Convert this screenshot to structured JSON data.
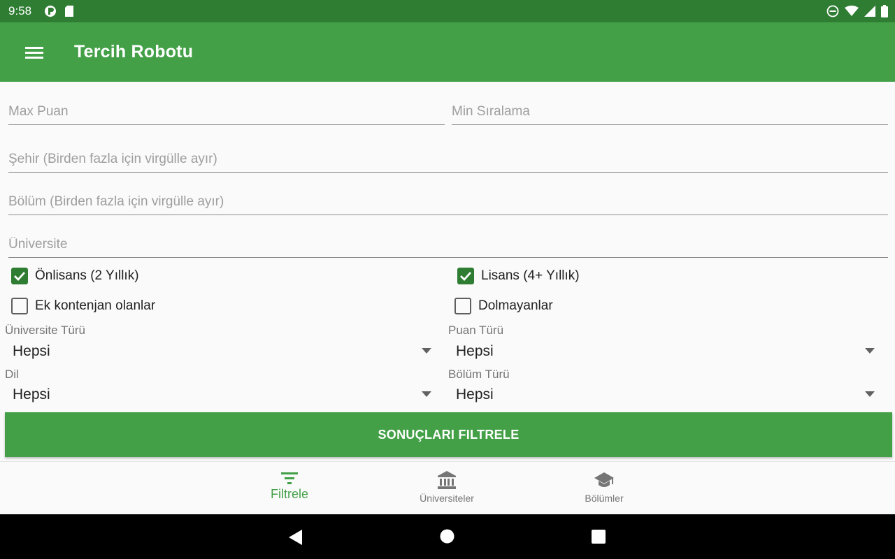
{
  "status_bar": {
    "time": "9:58",
    "left_icons": [
      "sync-icon",
      "sd-card-icon"
    ],
    "right_icons": [
      "do-not-disturb-icon",
      "wifi-icon",
      "signal-icon",
      "battery-icon"
    ]
  },
  "app_bar": {
    "title": "Tercih Robotu",
    "menu_icon": "menu-icon"
  },
  "form": {
    "max_puan": {
      "placeholder": "Max Puan",
      "value": ""
    },
    "min_siralama": {
      "placeholder": "Min Sıralama",
      "value": ""
    },
    "sehir": {
      "placeholder": "Şehir (Birden fazla için virgülle ayır)",
      "value": ""
    },
    "bolum": {
      "placeholder": "Bölüm (Birden fazla için virgülle ayır)",
      "value": ""
    },
    "universite": {
      "placeholder": "Üniversite",
      "value": ""
    },
    "checkboxes": {
      "onlisans": {
        "label": "Önlisans (2 Yıllık)",
        "checked": true
      },
      "lisans": {
        "label": "Lisans (4+ Yıllık)",
        "checked": true
      },
      "ek_kontenjan": {
        "label": "Ek kontenjan olanlar",
        "checked": false
      },
      "dolmayanlar": {
        "label": "Dolmayanlar",
        "checked": false
      }
    },
    "spinners": {
      "universite_turu": {
        "label": "Üniversite Türü",
        "value": "Hepsi"
      },
      "puan_turu": {
        "label": "Puan Türü",
        "value": "Hepsi"
      },
      "dil": {
        "label": "Dil",
        "value": "Hepsi"
      },
      "bolum_turu": {
        "label": "Bölüm Türü",
        "value": "Hepsi"
      }
    },
    "submit_label": "SONUÇLARI FILTRELE"
  },
  "bottom_nav": {
    "items": [
      {
        "label": "Filtrele",
        "icon": "filter-icon",
        "active": true
      },
      {
        "label": "Üniversiteler",
        "icon": "university-icon",
        "active": false
      },
      {
        "label": "Bölümler",
        "icon": "graduation-cap-icon",
        "active": false
      }
    ]
  },
  "colors": {
    "primary": "#43a047",
    "primary_dark": "#2e7d32",
    "checkbox": "#2e7d32",
    "inactive_text": "#757575"
  }
}
